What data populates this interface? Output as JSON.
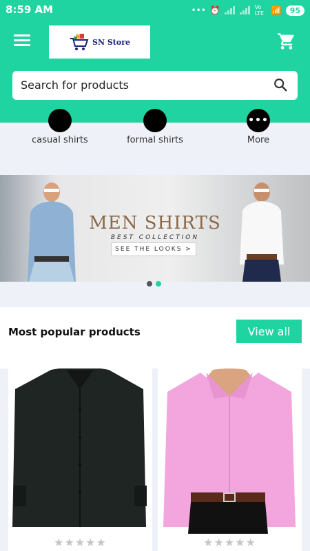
{
  "status_bar": {
    "time": "8:59 AM",
    "network": "Vo LTE",
    "battery": "95"
  },
  "header": {
    "logo_text": "SN Store"
  },
  "search": {
    "placeholder": "Search for products"
  },
  "categories": [
    {
      "label": "casual shirts"
    },
    {
      "label": "formal shirts"
    },
    {
      "label": "More"
    }
  ],
  "banner": {
    "title": "MEN SHIRTS",
    "subtitle": "BEST COLLECTION",
    "cta": "SEE THE LOOKS >",
    "slides": 2,
    "active_slide": 2
  },
  "popular": {
    "title": "Most popular products",
    "view_all": "View all",
    "products": [
      {
        "color": "#1e2522",
        "rating": 0
      },
      {
        "color": "#f2a6dd",
        "rating": 0
      }
    ]
  },
  "colors": {
    "accent": "#1fd4a1"
  },
  "icons": [
    "menu-icon",
    "cart-icon",
    "search-icon",
    "more-icon",
    "star-icon"
  ]
}
